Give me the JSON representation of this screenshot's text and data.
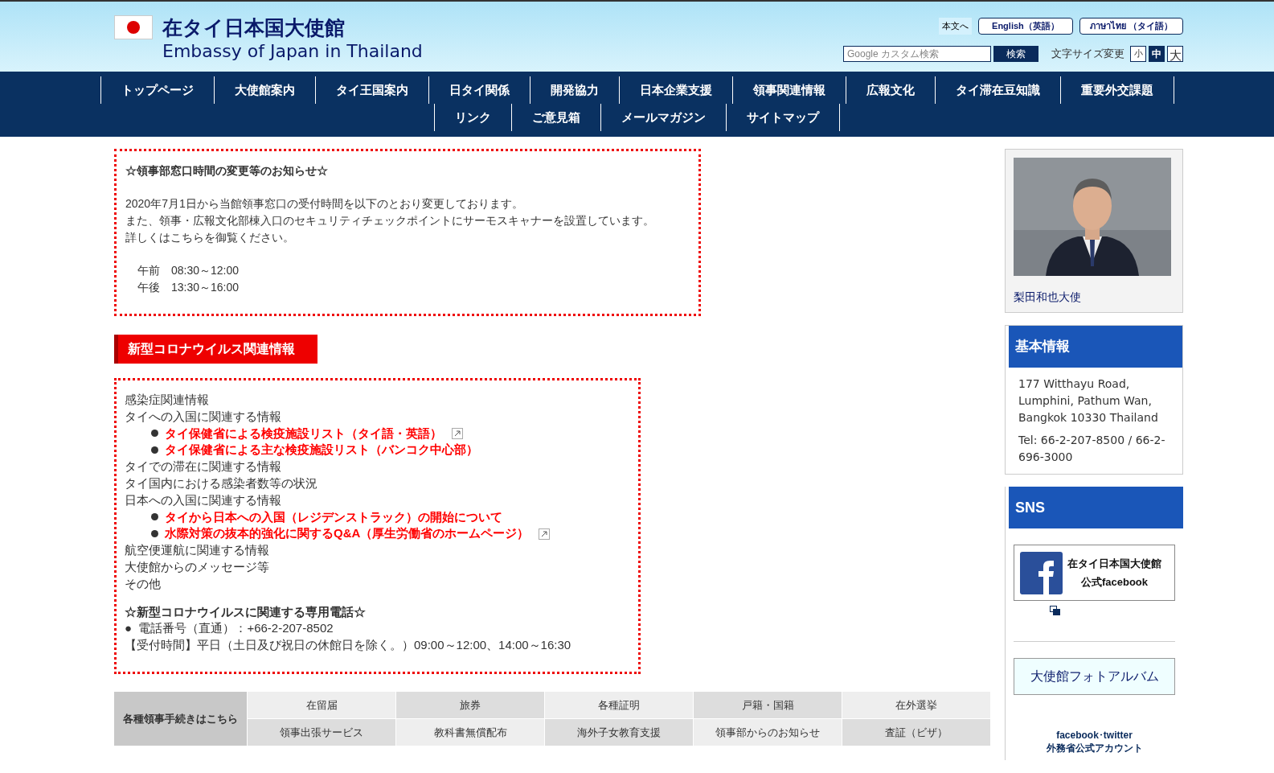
{
  "header": {
    "title_ja": "在タイ日本国大使館",
    "title_en": "Embassy of Japan in Thailand",
    "skip_link": "本文へ",
    "languages": [
      "English（英語）",
      "ภาษาไทย （タイ語）"
    ],
    "search": {
      "placeholder": "Google カスタム検索",
      "button": "検索"
    },
    "font_size": {
      "label": "文字サイズ変更",
      "options": [
        {
          "label": "小",
          "selected": false
        },
        {
          "label": "中",
          "selected": true
        },
        {
          "label": "大",
          "selected": false
        }
      ]
    }
  },
  "nav": {
    "items": [
      "トップページ",
      "大使館案内",
      "タイ王国案内",
      "日タイ関係",
      "開発協力",
      "日本企業支援",
      "領事関連情報",
      "広報文化",
      "タイ滞在豆知識",
      "重要外交課題",
      "リンク",
      "ご意見箱",
      "メールマガジン",
      "サイトマップ"
    ]
  },
  "notice": {
    "heading": "☆領事部窓口時間の変更等のお知らせ☆",
    "lines": [
      "2020年7月1日から当館領事窓口の受付時間を以下のとおり変更しております。",
      "また、領事・広報文化部棟入口のセキュリティチェックポイントにサーモスキャナーを設置しています。",
      "詳しくはこちらを御覧ください。"
    ],
    "hours": [
      "午前　08:30～12:00",
      "午後　13:30～16:00"
    ]
  },
  "covid": {
    "title": "新型コロナウイルス関連情報",
    "items": [
      {
        "kind": "link",
        "text": "感染症関連情報",
        "external": false
      },
      {
        "kind": "link",
        "text": "タイへの入国に関連する情報",
        "external": false
      },
      {
        "kind": "bullet",
        "text": "タイ保健省による検疫施設リスト（タイ語・英語）",
        "external": true
      },
      {
        "kind": "bullet",
        "text": "タイ保健省による主な検疫施設リスト（バンコク中心部）",
        "external": false
      },
      {
        "kind": "link",
        "text": "タイでの滞在に関連する情報",
        "external": false
      },
      {
        "kind": "link",
        "text": "タイ国内における感染者数等の状況",
        "external": false
      },
      {
        "kind": "link",
        "text": "日本への入国に関連する情報",
        "external": false
      },
      {
        "kind": "bullet",
        "text": "タイから日本への入国（レジデンストラック）の開始について",
        "external": false
      },
      {
        "kind": "bullet",
        "text": "水際対策の抜本的強化に関するQ&A（厚生労働省のホームページ）",
        "external": true
      },
      {
        "kind": "link",
        "text": "航空便運航に関連する情報",
        "external": false
      },
      {
        "kind": "link",
        "text": "大使館からのメッセージ等",
        "external": false
      },
      {
        "kind": "link",
        "text": "その他",
        "external": false
      }
    ],
    "phone_heading": "☆新型コロナウイルスに関連する専用電話☆",
    "phone": "●  電話番号（直通）：+66-2-207-8502",
    "hours": "【受付時間】平日（土日及び祝日の休館日を除く。）09:00～12:00、14:00～16:30"
  },
  "procedures": {
    "label": "各種領事手続きはこちら",
    "rows": [
      [
        "在留届",
        "旅券",
        "各種証明",
        "戸籍・国籍",
        "在外選挙"
      ],
      [
        "領事出張サービス",
        "教科書無償配布",
        "海外子女教育支援",
        "領事部からのお知らせ",
        "査証（ビザ）"
      ]
    ]
  },
  "sidebar": {
    "ambassador": {
      "caption": "梨田和也大使"
    },
    "basic": {
      "title": "基本情報",
      "address": "177 Witthayu Road, Lumphini, Pathum Wan, Bangkok 10330 Thailand",
      "tel": "Tel: 66-2-207-8500 / 66-2-696-3000"
    },
    "sns": {
      "title": "SNS",
      "facebook_line1": "在タイ日本国大使館",
      "facebook_line2": "公式facebook",
      "album": "大使館フォトアルバム",
      "mofa_line1": "facebook･twitter",
      "mofa_line2": "外務省公式アカウント"
    }
  }
}
